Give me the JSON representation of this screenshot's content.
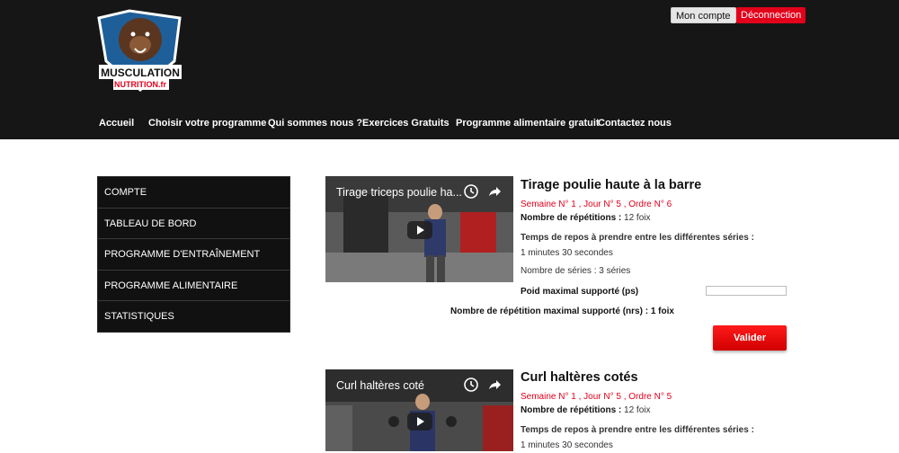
{
  "header": {
    "logo_text": "MUSCULATION NUTRITION.fr",
    "account_button": "Mon compte",
    "logout_button": "Déconnection",
    "nav": [
      "Accueil",
      "Choisir votre programme",
      "Qui sommes nous ?",
      "Exercices Gratuits",
      "Programme alimentaire gratuit",
      "Contactez nous"
    ]
  },
  "sidebar": {
    "items": [
      {
        "label": "COMPTE"
      },
      {
        "label": "TABLEAU DE BORD"
      },
      {
        "label": "PROGRAMME D'ENTRAÎNEMENT"
      },
      {
        "label": "PROGRAMME ALIMENTAIRE"
      },
      {
        "label": "STATISTIQUES"
      }
    ]
  },
  "exercises": [
    {
      "video_title": "Tirage triceps poulie ha...",
      "title": "Tirage poulie haute à la barre",
      "meta": "Semaine N° 1 , Jour N° 5 , Ordre N° 6",
      "reps_label": "Nombre de répétitions :",
      "reps_value": "12 foix",
      "rest_label": "Temps de repos à prendre entre les différentes séries :",
      "rest_value": "1 minutes 30 secondes",
      "series_text": "Nombre de séries : 3 séries",
      "max_weight_label": "Poid maximal supporté (ps)",
      "max_reps_label": "Nombre de répétition maximal supporté (nrs) :",
      "max_reps_value": "1 foix",
      "validate_button": "Valider"
    },
    {
      "video_title": "Curl haltères coté",
      "title": "Curl haltères cotés",
      "meta": "Semaine N° 1 , Jour N° 5 , Ordre N° 5",
      "reps_label": "Nombre de répétitions :",
      "reps_value": "12 foix",
      "rest_label": "Temps de repos à prendre entre les différentes séries :",
      "rest_value": "1 minutes 30 secondes"
    }
  ],
  "colors": {
    "header_bg": "#161616",
    "accent_red": "#e3001b",
    "sidebar_bg": "#111111"
  }
}
